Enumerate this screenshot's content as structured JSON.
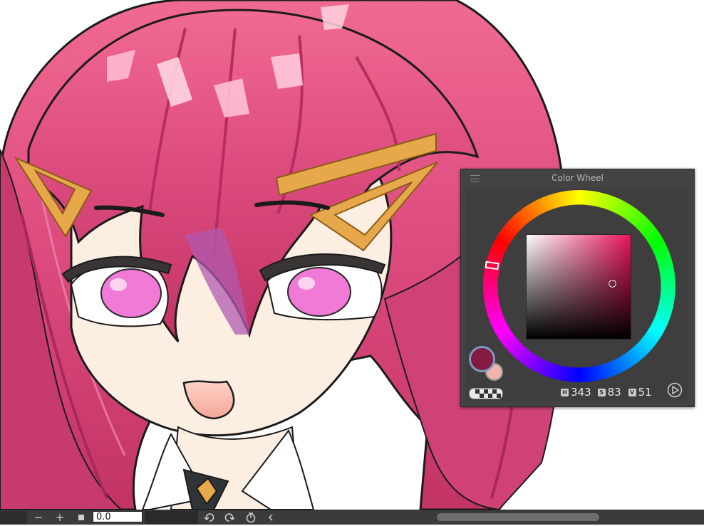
{
  "color_wheel": {
    "title": "Color Wheel",
    "hue_label": "H",
    "hue_value": "343",
    "saturation_label": "S",
    "saturation_value": "83",
    "value_label": "V",
    "value_value": "51",
    "main_color": "#821b3f",
    "sub_color": "#f0b3ad"
  },
  "bottom_bar": {
    "zoom_out_label": "−",
    "zoom_in_label": "+",
    "rotation_value": "0.0"
  },
  "colors": {
    "hair": "#e04d80",
    "skin": "#fdeee2",
    "clip": "#e6a84a",
    "eye": "#f07ad6",
    "panel": "#434343"
  }
}
